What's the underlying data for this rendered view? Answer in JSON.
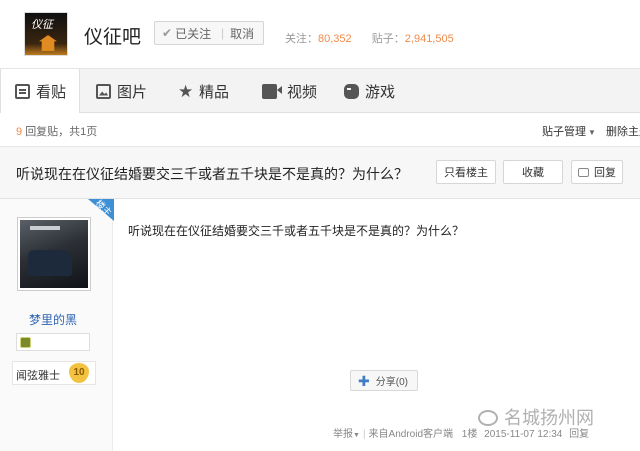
{
  "header": {
    "bar_name": "仪征吧",
    "follow_label": "已关注",
    "follow_sep": "|",
    "cancel_label": "取消",
    "followers_label": "关注：",
    "followers": "80,352",
    "posts_label": "贴子：",
    "posts": "2,941,505"
  },
  "tabs": [
    {
      "label": "看贴",
      "icon": "doc-icon"
    },
    {
      "label": "图片",
      "icon": "picture-icon"
    },
    {
      "label": "精品",
      "icon": "star-icon"
    },
    {
      "label": "视频",
      "icon": "video-icon"
    },
    {
      "label": "游戏",
      "icon": "gamepad-icon"
    }
  ],
  "subbar": {
    "reply_count": "9",
    "reply_text": "回复贴，共1页",
    "manage_label": "贴子管理",
    "delete_label": "删除主题"
  },
  "thread": {
    "title": "听说现在在仪征结婚要交三千或者五千块是不是真的？为什么？",
    "only_op": "只看楼主",
    "collect": "收藏",
    "reply": "回复"
  },
  "author": {
    "badge": "楼主",
    "name": "梦里的黑",
    "rank_title": "闻弦雅士",
    "level": "10"
  },
  "post": {
    "content": "听说现在在仪征结婚要交三千或者五千块是不是真的？为什么？",
    "share_label": "分享(0)",
    "report": "举报",
    "source": "来自Android客户端",
    "floor": "1楼",
    "time": "2015-11-07 12:34",
    "reply": "回复"
  },
  "watermark": {
    "text": "名城扬州网"
  },
  "colors": {
    "accent_orange": "#f08a4a",
    "link_blue": "#2d64b3",
    "badge_blue": "#3f8fd5"
  }
}
